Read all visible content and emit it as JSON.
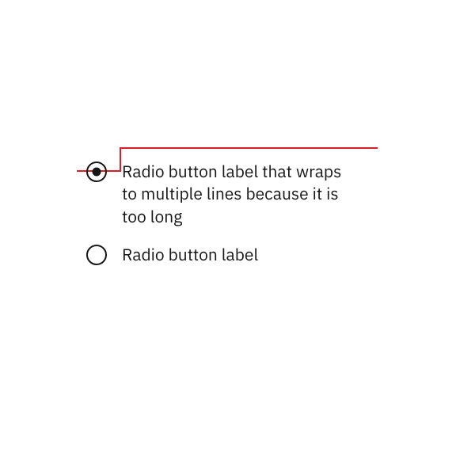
{
  "colors": {
    "annotation": "#da1e28",
    "foreground": "#161616"
  },
  "radios": [
    {
      "label": "Radio button label that wraps to multiple lines because it is too long",
      "selected": true
    },
    {
      "label": "Radio button label",
      "selected": false
    }
  ]
}
